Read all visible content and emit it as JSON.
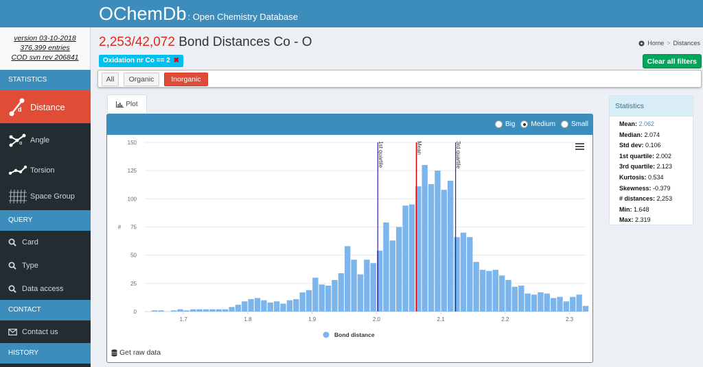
{
  "header": {
    "brand": "OChemDb",
    "subtitle": ": Open Chemistry Database"
  },
  "sidebar": {
    "info": [
      "version 03-10-2018",
      "376,399 entries",
      "COD svn rev 206841"
    ],
    "sections": {
      "statistics": "STATISTICS",
      "query": "QUERY",
      "contact": "CONTACT",
      "history": "HISTORY"
    },
    "items": {
      "distance": "Distance",
      "angle": "Angle",
      "torsion": "Torsion",
      "space_group": "Space Group",
      "card": "Card",
      "type": "Type",
      "data_access": "Data access",
      "contact_us": "Contact us"
    }
  },
  "page": {
    "count": "2,253/42,072",
    "title_rest": " Bond Distances Co - O",
    "breadcrumb": [
      "Home",
      "Distances"
    ],
    "filter_tag": "Oxidation nr Co == 2",
    "clear_filters": "Clear all filters",
    "segments": [
      "All",
      "Organic",
      "Inorganic"
    ],
    "active_segment": "Inorganic",
    "tab_label": "Plot",
    "size_options": [
      "Big",
      "Medium",
      "Small"
    ],
    "selected_size": "Medium",
    "raw_data_label": "Get raw data"
  },
  "stats": {
    "title": "Statistics",
    "rows": [
      {
        "label": "Mean:",
        "value": "2.062"
      },
      {
        "label": "Median:",
        "value": "2.074"
      },
      {
        "label": "Std dev:",
        "value": "0.106"
      },
      {
        "label": "1st quartile:",
        "value": "2.002"
      },
      {
        "label": "3rd quartile:",
        "value": "2.123"
      },
      {
        "label": "Kurtosis:",
        "value": "0.534"
      },
      {
        "label": "Skewness:",
        "value": "-0.379"
      },
      {
        "label": "# distances:",
        "value": "2,253"
      },
      {
        "label": "Min:",
        "value": "1.648"
      },
      {
        "label": "Max:",
        "value": "2.319"
      }
    ]
  },
  "colors": {
    "primary": "#3c8dbc",
    "active": "#dd4b39",
    "bar": "#7cb5ec",
    "mean_line": "#dd0000",
    "quartile_line": "#000088"
  },
  "chart_data": {
    "type": "bar",
    "xlim": [
      1.64,
      2.325
    ],
    "ylim": [
      0,
      150
    ],
    "bin_width": 0.01,
    "x_ticks": [
      1.7,
      1.8,
      1.9,
      2.0,
      2.1,
      2.2,
      2.3
    ],
    "y_ticks": [
      0,
      25,
      50,
      75,
      100,
      125,
      150
    ],
    "ylabel": "#",
    "legend": "Bond distance",
    "lines": [
      {
        "label": "1st quartile",
        "x": 2.002
      },
      {
        "label": "Mean",
        "x": 2.062
      },
      {
        "label": "3rd quartile",
        "x": 2.123
      }
    ],
    "bins": [
      {
        "x": 1.655,
        "y": 1
      },
      {
        "x": 1.665,
        "y": 1
      },
      {
        "x": 1.675,
        "y": 0
      },
      {
        "x": 1.685,
        "y": 1
      },
      {
        "x": 1.695,
        "y": 2
      },
      {
        "x": 1.705,
        "y": 1
      },
      {
        "x": 1.715,
        "y": 2
      },
      {
        "x": 1.725,
        "y": 2
      },
      {
        "x": 1.735,
        "y": 2
      },
      {
        "x": 1.745,
        "y": 2
      },
      {
        "x": 1.755,
        "y": 2
      },
      {
        "x": 1.765,
        "y": 2
      },
      {
        "x": 1.775,
        "y": 4
      },
      {
        "x": 1.785,
        "y": 6
      },
      {
        "x": 1.795,
        "y": 9
      },
      {
        "x": 1.805,
        "y": 11
      },
      {
        "x": 1.815,
        "y": 12
      },
      {
        "x": 1.825,
        "y": 10
      },
      {
        "x": 1.835,
        "y": 8
      },
      {
        "x": 1.845,
        "y": 9
      },
      {
        "x": 1.855,
        "y": 7
      },
      {
        "x": 1.865,
        "y": 10
      },
      {
        "x": 1.875,
        "y": 11
      },
      {
        "x": 1.885,
        "y": 17
      },
      {
        "x": 1.895,
        "y": 19
      },
      {
        "x": 1.905,
        "y": 30
      },
      {
        "x": 1.915,
        "y": 24
      },
      {
        "x": 1.925,
        "y": 23
      },
      {
        "x": 1.935,
        "y": 28
      },
      {
        "x": 1.945,
        "y": 34
      },
      {
        "x": 1.955,
        "y": 58
      },
      {
        "x": 1.965,
        "y": 46
      },
      {
        "x": 1.975,
        "y": 33
      },
      {
        "x": 1.985,
        "y": 46
      },
      {
        "x": 1.995,
        "y": 43
      },
      {
        "x": 2.005,
        "y": 54
      },
      {
        "x": 2.015,
        "y": 79
      },
      {
        "x": 2.025,
        "y": 63
      },
      {
        "x": 2.035,
        "y": 75
      },
      {
        "x": 2.045,
        "y": 94
      },
      {
        "x": 2.055,
        "y": 95
      },
      {
        "x": 2.065,
        "y": 111
      },
      {
        "x": 2.075,
        "y": 130
      },
      {
        "x": 2.085,
        "y": 113
      },
      {
        "x": 2.095,
        "y": 125
      },
      {
        "x": 2.105,
        "y": 108
      },
      {
        "x": 2.115,
        "y": 116
      },
      {
        "x": 2.125,
        "y": 66
      },
      {
        "x": 2.135,
        "y": 70
      },
      {
        "x": 2.145,
        "y": 66
      },
      {
        "x": 2.155,
        "y": 44
      },
      {
        "x": 2.165,
        "y": 37
      },
      {
        "x": 2.175,
        "y": 36
      },
      {
        "x": 2.185,
        "y": 37
      },
      {
        "x": 2.195,
        "y": 32
      },
      {
        "x": 2.205,
        "y": 28
      },
      {
        "x": 2.215,
        "y": 22
      },
      {
        "x": 2.225,
        "y": 23
      },
      {
        "x": 2.235,
        "y": 16
      },
      {
        "x": 2.245,
        "y": 15
      },
      {
        "x": 2.255,
        "y": 17
      },
      {
        "x": 2.265,
        "y": 16
      },
      {
        "x": 2.275,
        "y": 12
      },
      {
        "x": 2.285,
        "y": 13
      },
      {
        "x": 2.295,
        "y": 9
      },
      {
        "x": 2.305,
        "y": 13
      },
      {
        "x": 2.315,
        "y": 15
      },
      {
        "x": 2.325,
        "y": 5
      }
    ]
  }
}
